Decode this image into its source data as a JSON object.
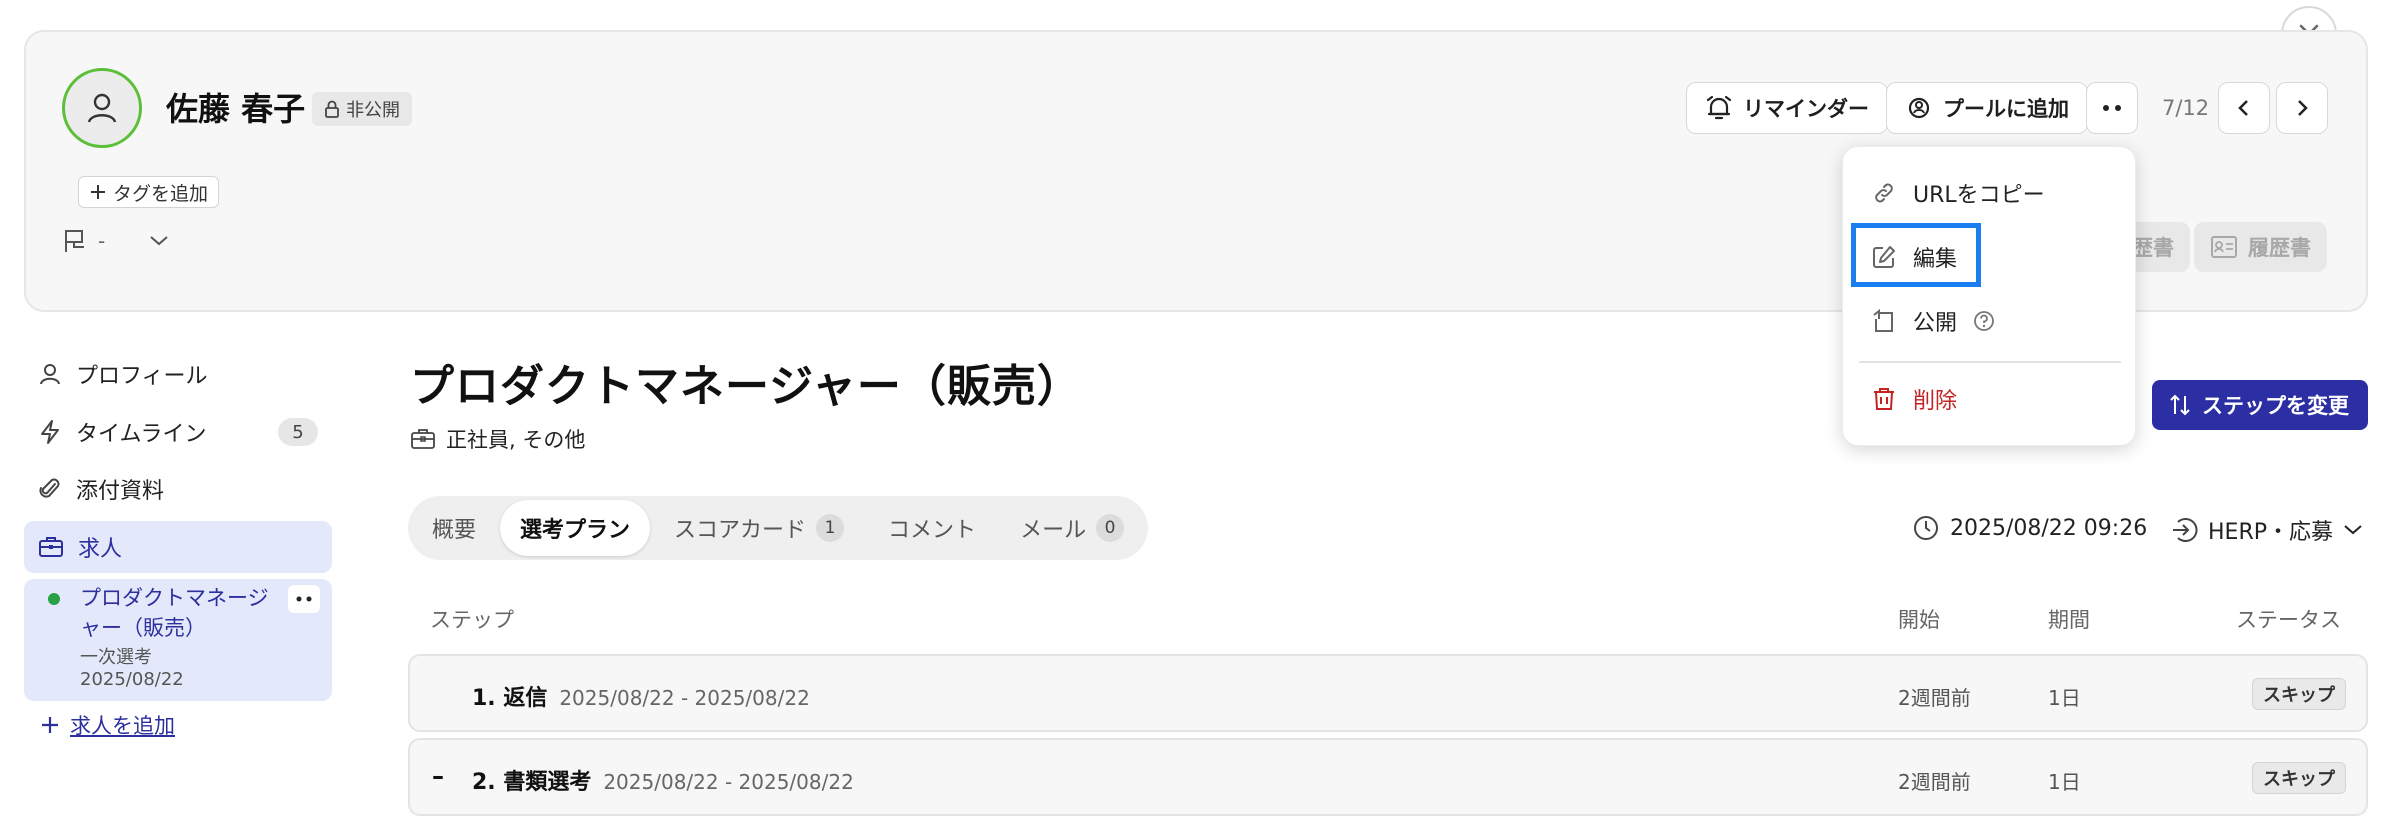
{
  "candidate": {
    "name": "佐藤 春子",
    "visibility_label": "非公開",
    "add_tag_label": "タグを追加",
    "flag_value": "-"
  },
  "header_actions": {
    "reminder_label": "リマインダー",
    "pool_label": "プールに追加",
    "pager": "7/12"
  },
  "documents": {
    "resume_label": "履歴書",
    "cv_label": "履歴書",
    "partial_label": "歴書"
  },
  "menu": {
    "copy_url": "URLをコピー",
    "edit": "編集",
    "publish": "公開",
    "delete": "削除"
  },
  "sidebar": {
    "items": [
      {
        "label": "プロフィール"
      },
      {
        "label": "タイムライン",
        "count": "5"
      },
      {
        "label": "添付資料"
      },
      {
        "label": "求人"
      }
    ],
    "job_card": {
      "title": "プロダクトマネージャー（販売）",
      "stage": "一次選考",
      "date": "2025/08/22"
    },
    "add_job_label": "求人を追加"
  },
  "main": {
    "title": "プロダクトマネージャー（販売）",
    "employment_type": "正社員, その他",
    "step_change_label": "ステップを変更",
    "tabs": [
      {
        "label": "概要"
      },
      {
        "label": "選考プラン",
        "active": true
      },
      {
        "label": "スコアカード",
        "count": "1"
      },
      {
        "label": "コメント"
      },
      {
        "label": "メール",
        "count": "0"
      }
    ],
    "datetime": "2025/08/22 09:26",
    "source": "HERP・応募"
  },
  "table": {
    "headers": {
      "step": "ステップ",
      "start": "開始",
      "period": "期間",
      "status": "ステータス"
    },
    "rows": [
      {
        "name": "1. 返信",
        "range": "2025/08/22 - 2025/08/22",
        "start": "2週間前",
        "period": "1日",
        "status": "スキップ"
      },
      {
        "name": "2. 書類選考",
        "range": "2025/08/22 - 2025/08/22",
        "start": "2週間前",
        "period": "1日",
        "status": "スキップ"
      }
    ]
  },
  "colors": {
    "accent": "#2b2fa3",
    "active_bg": "#e4e8fb",
    "avatar_ring": "#5cbf3a",
    "delete": "#c42323",
    "highlight": "#1a7df0"
  }
}
